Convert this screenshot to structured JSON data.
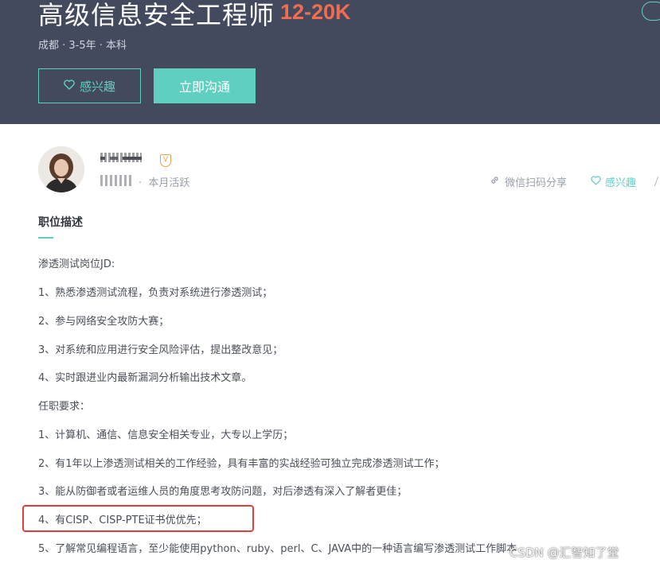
{
  "header": {
    "job_title": "高级信息安全工程师",
    "salary": "12-20K",
    "meta": "成都 · 3-5年 · 本科",
    "interest_button": "感兴趣",
    "chat_button": "立即沟通"
  },
  "recruiter": {
    "name": "",
    "company": "",
    "vip_badge": "V",
    "active_status": "本月活跃",
    "share_label": "微信扫码分享",
    "interest_label": "感兴趣"
  },
  "description": {
    "title": "职位描述",
    "lines": [
      "渗透测试岗位JD:",
      "1、熟悉渗透测试流程，负责对系统进行渗透测试；",
      "2、参与网络安全攻防大赛；",
      "3、对系统和应用进行安全风险评估，提出整改意见；",
      "4、实时跟进业内最新漏洞分析输出技术文章。",
      "任职要求：",
      "1、计算机、通信、信息安全相关专业，大专以上学历；",
      "2、有1年以上渗透测试相关的工作经验，具有丰富的实战经验可独立完成渗透测试工作；",
      "3、能从防御者或者运维人员的角度思考攻防问题，对后渗透有深入了解者更佳；",
      "4、有CISP、CISP-PTE证书优优先；",
      "5、了解常见编程语言，至少能使用python、ruby、perl、C、JAVA中的一种语言编写渗透测试工作脚本"
    ]
  },
  "watermark": "CSDN @汇智知了堂",
  "colors": {
    "header_bg": "#444a5e",
    "accent": "#5fcfc2",
    "salary": "#f26d4f",
    "highlight": "#e0403a"
  },
  "icons": {
    "interest": "heart-outline-icon",
    "share": "link-icon",
    "vip": "vip-badge-icon"
  }
}
